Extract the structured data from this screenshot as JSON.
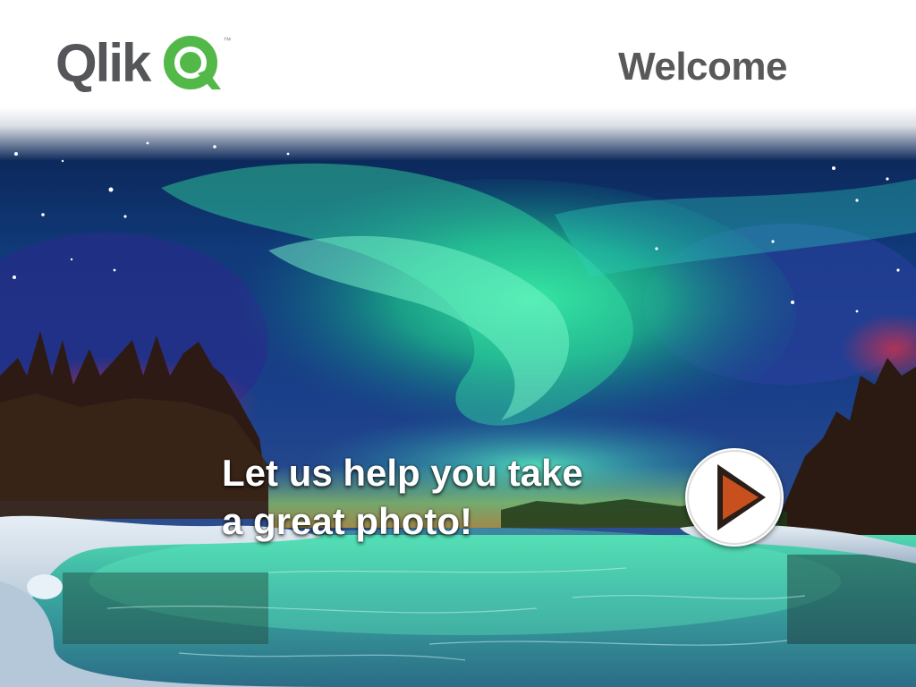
{
  "header": {
    "logo_text": "Qlik",
    "logo_tm": "™",
    "title": "Welcome"
  },
  "hero": {
    "tagline_line1": "Let us help you take",
    "tagline_line2": "a great photo!",
    "play_icon": "play-icon"
  },
  "colors": {
    "brand_green": "#52b848",
    "logo_gray": "#54565a",
    "title_gray": "#595959",
    "play_orange": "#c8501e"
  }
}
